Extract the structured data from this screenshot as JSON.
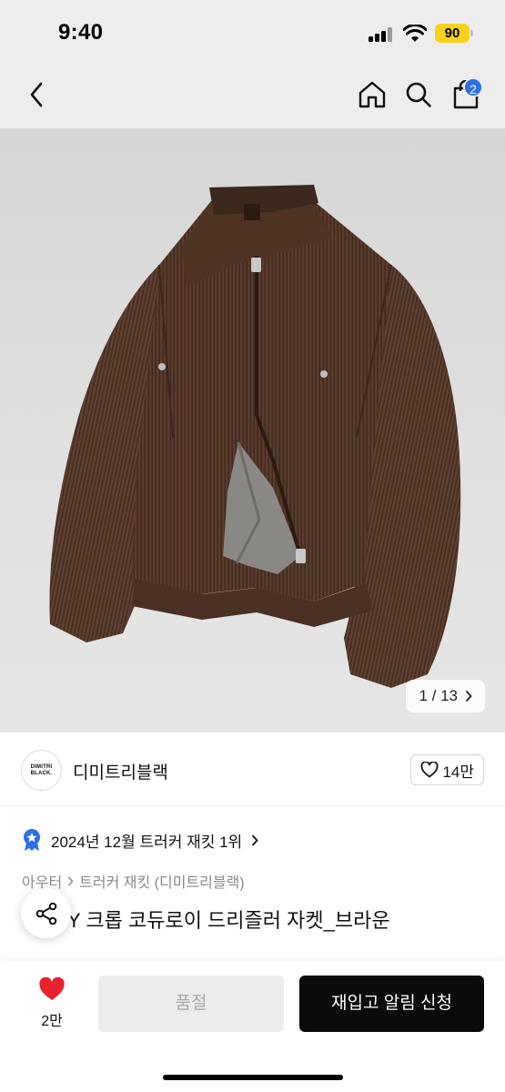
{
  "status_bar": {
    "time": "9:40",
    "battery": "90"
  },
  "nav": {
    "back_icon": "chevron-left-icon",
    "home_icon": "home-icon",
    "search_icon": "search-icon",
    "cart_icon": "shopping-bag-icon",
    "cart_count": "2"
  },
  "product_image": {
    "alt": "corduroy jacket",
    "counter": "1 / 13"
  },
  "brand": {
    "logo_line1": "DIMITRI",
    "logo_line2": "BLACK.",
    "name": "디미트리블랙",
    "likes": "14만"
  },
  "ranking": {
    "text": "2024년 12월 트러커 재킷 1위"
  },
  "breadcrumb": {
    "category": "아우터",
    "subcategory": "트러커 재킷 (디미트리블랙)"
  },
  "product": {
    "title": "Y 크롭 코듀로이 드리즐러 자켓_브라운"
  },
  "bottom_bar": {
    "wish_count": "2만",
    "soldout_label": "품절",
    "restock_label": "재입고 알림 신청"
  },
  "colors": {
    "accent_blue": "#2d6ee6",
    "heart_red": "#e8232d",
    "jacket_brown": "#5a3b2b"
  }
}
